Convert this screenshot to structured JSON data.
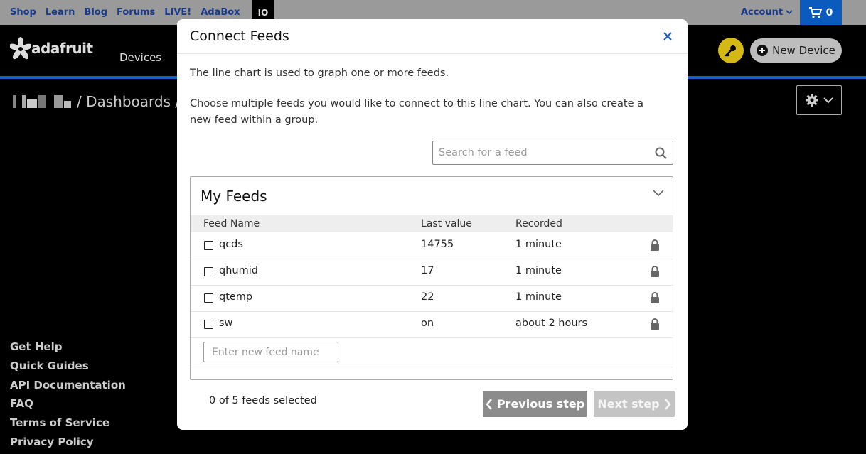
{
  "topnav": {
    "links": [
      "Shop",
      "Learn",
      "Blog",
      "Forums",
      "LIVE!",
      "AdaBox"
    ],
    "io": "IO",
    "account": "Account",
    "cart_count": "0"
  },
  "header": {
    "logo_text": "adafruit",
    "devices": "Devices",
    "new_device": "New Device"
  },
  "breadcrumb": {
    "text": "/ Dashboards /"
  },
  "footer": {
    "links": [
      "Get Help",
      "Quick Guides",
      "API Documentation",
      "FAQ",
      "Terms of Service",
      "Privacy Policy"
    ]
  },
  "modal": {
    "title": "Connect Feeds",
    "description1": "The line chart is used to graph one or more feeds.",
    "description2": "Choose multiple feeds you would like to connect to this line chart. You can also create a new feed within a group.",
    "search_placeholder": "Search for a feed",
    "group_title": "My Feeds",
    "columns": [
      "Feed Name",
      "Last value",
      "Recorded"
    ],
    "feeds": [
      {
        "name": "qcds",
        "last_value": "14755",
        "recorded": "1 minute"
      },
      {
        "name": "qhumid",
        "last_value": "17",
        "recorded": "1 minute"
      },
      {
        "name": "qtemp",
        "last_value": "22",
        "recorded": "1 minute"
      },
      {
        "name": "sw",
        "last_value": "on",
        "recorded": "about 2 hours"
      }
    ],
    "new_feed_placeholder": "Enter new feed name",
    "selected_text": "0 of 5 feeds selected",
    "previous_label": "Previous step",
    "next_label": "Next step"
  },
  "colors": {
    "accent": "#1e5fbf",
    "key_button": "#d4b814"
  }
}
